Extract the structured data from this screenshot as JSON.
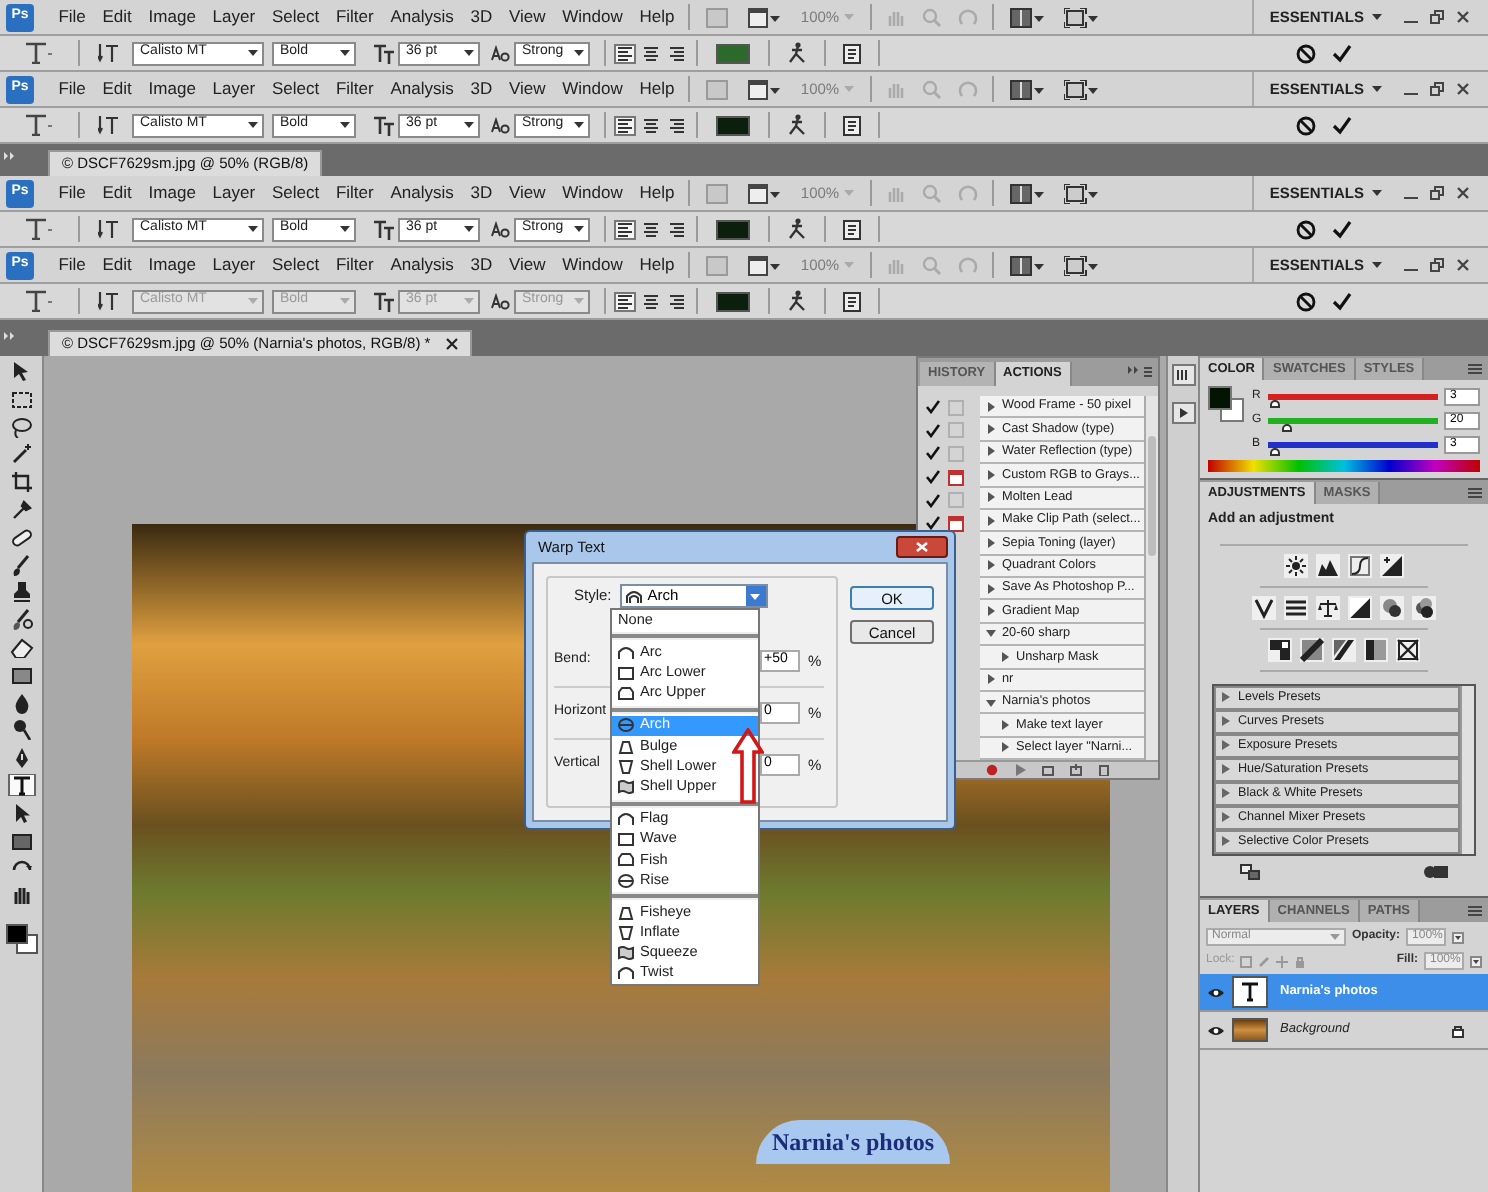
{
  "bars": [
    {
      "kind": "menu",
      "logo": "Ps",
      "items": [
        "File",
        "Edit",
        "Image",
        "Layer",
        "Select",
        "Filter",
        "Analysis",
        "3D",
        "View",
        "Window",
        "Help"
      ],
      "zoom": "100%",
      "workspace": "ESSENTIALS"
    },
    {
      "kind": "options",
      "font": "Calisto MT",
      "style": "Bold",
      "size": "36 pt",
      "antialias": "Strong",
      "alignments": [
        {
          "selected": true
        },
        {
          "selected": false
        },
        {
          "selected": false
        }
      ],
      "color": "#2b6a2b",
      "disabled": false
    },
    {
      "kind": "menu",
      "logo": "Ps",
      "items": [
        "File",
        "Edit",
        "Image",
        "Layer",
        "Select",
        "Filter",
        "Analysis",
        "3D",
        "View",
        "Window",
        "Help"
      ],
      "zoom": "100%",
      "workspace": "ESSENTIALS"
    },
    {
      "kind": "options",
      "font": "Calisto MT",
      "style": "Bold",
      "size": "36 pt",
      "antialias": "Strong",
      "alignments": [
        {
          "selected": true
        },
        {
          "selected": false
        },
        {
          "selected": false
        }
      ],
      "color": "#0c1f0c",
      "disabled": false
    },
    {
      "kind": "doc_tab",
      "title": "© DSCF7629sm.jpg @ 50% (RGB/8)",
      "closable": false
    },
    {
      "kind": "menu",
      "logo": "Ps",
      "items": [
        "File",
        "Edit",
        "Image",
        "Layer",
        "Select",
        "Filter",
        "Analysis",
        "3D",
        "View",
        "Window",
        "Help"
      ],
      "zoom": "100%",
      "workspace": "ESSENTIALS"
    },
    {
      "kind": "options",
      "font": "Calisto MT",
      "style": "Bold",
      "size": "36 pt",
      "antialias": "Strong",
      "alignments": [
        {
          "selected": true
        },
        {
          "selected": false
        },
        {
          "selected": false
        }
      ],
      "color": "#0c1f0c",
      "disabled": false
    },
    {
      "kind": "menu",
      "logo": "Ps",
      "items": [
        "File",
        "Edit",
        "Image",
        "Layer",
        "Select",
        "Filter",
        "Analysis",
        "3D",
        "View",
        "Window",
        "Help"
      ],
      "zoom": "100%",
      "workspace": "ESSENTIALS"
    },
    {
      "kind": "options",
      "font": "Calisto MT",
      "style": "Bold",
      "size": "36 pt",
      "antialias": "Strong",
      "alignments": [
        {
          "selected": true
        },
        {
          "selected": false
        },
        {
          "selected": false
        }
      ],
      "color": "#0c1f0c",
      "disabled": true
    },
    {
      "kind": "doc_tab",
      "title": "© DSCF7629sm.jpg @ 50% (Narnia's photos, RGB/8) *",
      "closable": true
    }
  ],
  "toolbox": {
    "tools": [
      {
        "selected": false
      },
      {
        "selected": false
      },
      {
        "selected": false
      },
      {
        "selected": false
      },
      {
        "selected": false
      },
      {
        "selected": false
      },
      {
        "selected": false
      },
      {
        "selected": false
      },
      {
        "selected": false
      },
      {
        "selected": false
      },
      {
        "selected": false
      },
      {
        "selected": false
      },
      {
        "selected": false
      },
      {
        "selected": false
      },
      {
        "selected": false
      },
      {
        "selected": true
      },
      {
        "selected": false
      },
      {
        "selected": false
      },
      {
        "selected": false
      },
      {
        "selected": false
      }
    ]
  },
  "canvas": {
    "text_layer": "Narnia's photos"
  },
  "actions_panel": {
    "tabs": [
      {
        "label": "HISTORY",
        "selected": false
      },
      {
        "label": "ACTIONS",
        "selected": true
      }
    ],
    "toggles": [
      {
        "checked": true,
        "dialog": false
      },
      {
        "checked": true,
        "dialog": false
      },
      {
        "checked": true,
        "dialog": false
      },
      {
        "checked": true,
        "dialog": true
      },
      {
        "checked": true,
        "dialog": false
      },
      {
        "checked": true,
        "dialog": true
      }
    ],
    "actions": [
      {
        "label": "Wood Frame - 50 pixel",
        "expanded": false
      },
      {
        "label": "Cast Shadow (type)",
        "expanded": false
      },
      {
        "label": "Water Reflection (type)",
        "expanded": false
      },
      {
        "label": "Custom RGB to Grays...",
        "expanded": false
      },
      {
        "label": "Molten Lead",
        "expanded": false
      },
      {
        "label": "Make Clip Path (select...",
        "expanded": false
      },
      {
        "label": "Sepia Toning (layer)",
        "expanded": false
      },
      {
        "label": "Quadrant Colors",
        "expanded": false
      },
      {
        "label": "Save As Photoshop P...",
        "expanded": false
      },
      {
        "label": "Gradient Map",
        "expanded": false
      },
      {
        "label": "20-60 sharp",
        "expanded": true,
        "children": [
          {
            "label": "Unsharp Mask",
            "expanded": false
          }
        ]
      },
      {
        "label": "nr",
        "expanded": false
      },
      {
        "label": "Narnia's photos",
        "expanded": true,
        "children": [
          {
            "label": "Make text layer",
            "expanded": false
          },
          {
            "label": "Select layer \"Narni...",
            "expanded": false
          }
        ]
      }
    ]
  },
  "color_panel": {
    "tabs": [
      {
        "label": "COLOR",
        "selected": true
      },
      {
        "label": "SWATCHES",
        "selected": false
      },
      {
        "label": "STYLES",
        "selected": false
      }
    ],
    "channels": [
      {
        "name": "R",
        "level": 0.012,
        "reading": "3",
        "color": "#d42020"
      },
      {
        "name": "G",
        "level": 0.08,
        "reading": "20",
        "color": "#20b020"
      },
      {
        "name": "B",
        "level": 0.012,
        "reading": "3",
        "color": "#2030c8"
      }
    ]
  },
  "adjustments_panel": {
    "tabs": [
      {
        "label": "ADJUSTMENTS",
        "selected": true
      },
      {
        "label": "MASKS",
        "selected": false
      }
    ],
    "heading": "Add an adjustment",
    "presets": [
      "Levels Presets",
      "Curves Presets",
      "Exposure Presets",
      "Hue/Saturation Presets",
      "Black & White Presets",
      "Channel Mixer Presets",
      "Selective Color Presets"
    ]
  },
  "layers_panel": {
    "tabs": [
      {
        "label": "LAYERS",
        "selected": true
      },
      {
        "label": "CHANNELS",
        "selected": false
      },
      {
        "label": "PATHS",
        "selected": false
      }
    ],
    "blend_mode": "Normal",
    "opacity_label": "Opacity:",
    "opacity": "100%",
    "lock_label": "Lock:",
    "fill_label": "Fill:",
    "fill": "100%",
    "layers": [
      {
        "kind": "text",
        "name": "Narnia's photos",
        "selected": true,
        "locked": false
      },
      {
        "kind": "image",
        "name": "Background",
        "selected": false,
        "locked": true
      }
    ]
  },
  "warp_dialog": {
    "title": "Warp Text",
    "style_label": "Style:",
    "style_value": "Arch",
    "rows": [
      {
        "label": "Bend:",
        "value": "+50",
        "unit": "%"
      },
      {
        "label": "Horizont",
        "value": "0",
        "unit": "%"
      },
      {
        "label": "Vertical",
        "value": "0",
        "unit": "%"
      }
    ],
    "buttons": [
      "OK",
      "Cancel"
    ],
    "style_menu": [
      {
        "items": [
          {
            "label": "None",
            "selected": false
          }
        ]
      },
      {
        "items": [
          {
            "label": "Arc",
            "selected": false
          },
          {
            "label": "Arc Lower",
            "selected": false
          },
          {
            "label": "Arc Upper",
            "selected": false
          }
        ]
      },
      {
        "items": [
          {
            "label": "Arch",
            "selected": true
          },
          {
            "label": "Bulge",
            "selected": false
          },
          {
            "label": "Shell Lower",
            "selected": false
          },
          {
            "label": "Shell Upper",
            "selected": false
          }
        ]
      },
      {
        "items": [
          {
            "label": "Flag",
            "selected": false
          },
          {
            "label": "Wave",
            "selected": false
          },
          {
            "label": "Fish",
            "selected": false
          },
          {
            "label": "Rise",
            "selected": false
          }
        ]
      },
      {
        "items": [
          {
            "label": "Fisheye",
            "selected": false
          },
          {
            "label": "Inflate",
            "selected": false
          },
          {
            "label": "Squeeze",
            "selected": false
          },
          {
            "label": "Twist",
            "selected": false
          }
        ]
      }
    ]
  }
}
